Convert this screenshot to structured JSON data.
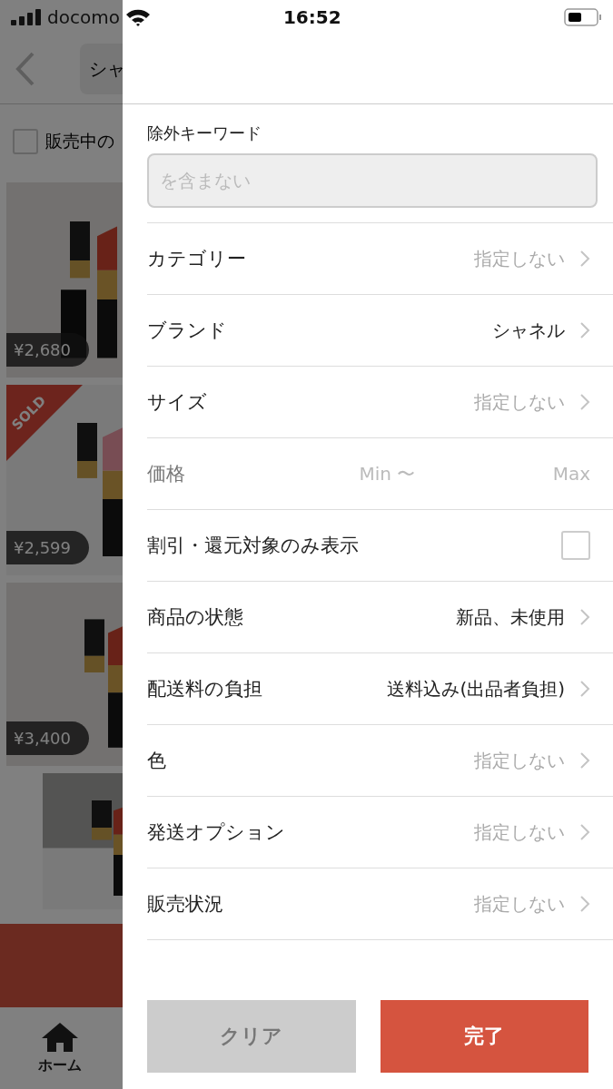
{
  "status_bar": {
    "carrier": "docomo",
    "time": "16:52"
  },
  "background": {
    "search_text": "シャ",
    "checkbox": {
      "label": "販売中の",
      "checked": false
    },
    "items": [
      {
        "price": "¥2,680",
        "sold": false
      },
      {
        "price": "¥2,599",
        "sold": true,
        "badge": "SOLD"
      },
      {
        "price": "¥3,400",
        "sold": false
      },
      {
        "sold": false
      }
    ],
    "tab": {
      "label": "ホーム"
    }
  },
  "filter": {
    "exclude_keyword": {
      "label": "除外キーワード",
      "placeholder": "を含まない"
    },
    "rows": [
      {
        "kind": "select",
        "label": "カテゴリー",
        "value": "指定しない",
        "set": false
      },
      {
        "kind": "select",
        "label": "ブランド",
        "value": "シャネル",
        "set": true
      },
      {
        "kind": "select",
        "label": "サイズ",
        "value": "指定しない",
        "set": false
      },
      {
        "kind": "range",
        "label": "価格",
        "min": "Min 〜",
        "max": "Max"
      },
      {
        "kind": "checkbox",
        "label": "割引・還元対象のみ表示",
        "checked": false
      },
      {
        "kind": "select",
        "label": "商品の状態",
        "value": "新品、未使用",
        "set": true
      },
      {
        "kind": "select",
        "label": "配送料の負担",
        "value": "送料込み(出品者負担)",
        "set": true
      },
      {
        "kind": "select",
        "label": "色",
        "value": "指定しない",
        "set": false
      },
      {
        "kind": "select",
        "label": "発送オプション",
        "value": "指定しない",
        "set": false
      },
      {
        "kind": "select",
        "label": "販売状況",
        "value": "指定しない",
        "set": false
      }
    ],
    "buttons": {
      "clear": "クリア",
      "done": "完了"
    }
  }
}
